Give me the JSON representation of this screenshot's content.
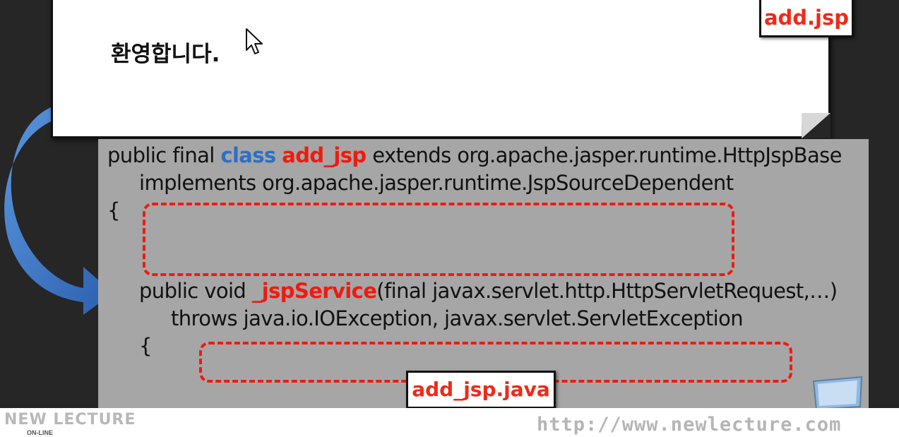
{
  "browser": {
    "welcome_text": "환영합니다.",
    "file_label": "add.jsp"
  },
  "code": {
    "line1": {
      "pre": "public final ",
      "kw1": "class",
      "mid": " ",
      "kw2": "add_jsp",
      "post": " extends org.apache.jasper.runtime.HttpJspBase"
    },
    "line2": "implements org.apache.jasper.runtime.JspSourceDependent",
    "line3": "{",
    "line4": {
      "pre": "public void ",
      "kw": "_jspService",
      "post": "(final javax.servlet.http.HttpServletRequest,…)"
    },
    "line5": "throws java.io.IOException, javax.servlet.ServletException",
    "line6": "{",
    "file_label": "add_jsp.java"
  },
  "footer": {
    "logo_text": "NEW LECTURE",
    "logo_sub": "ON-LINE",
    "url": "http://www.newlecture.com"
  },
  "colors": {
    "keyword_blue": "#2e6fc4",
    "keyword_red": "#ef1a10",
    "arrow_blue": "#3b78c8"
  }
}
